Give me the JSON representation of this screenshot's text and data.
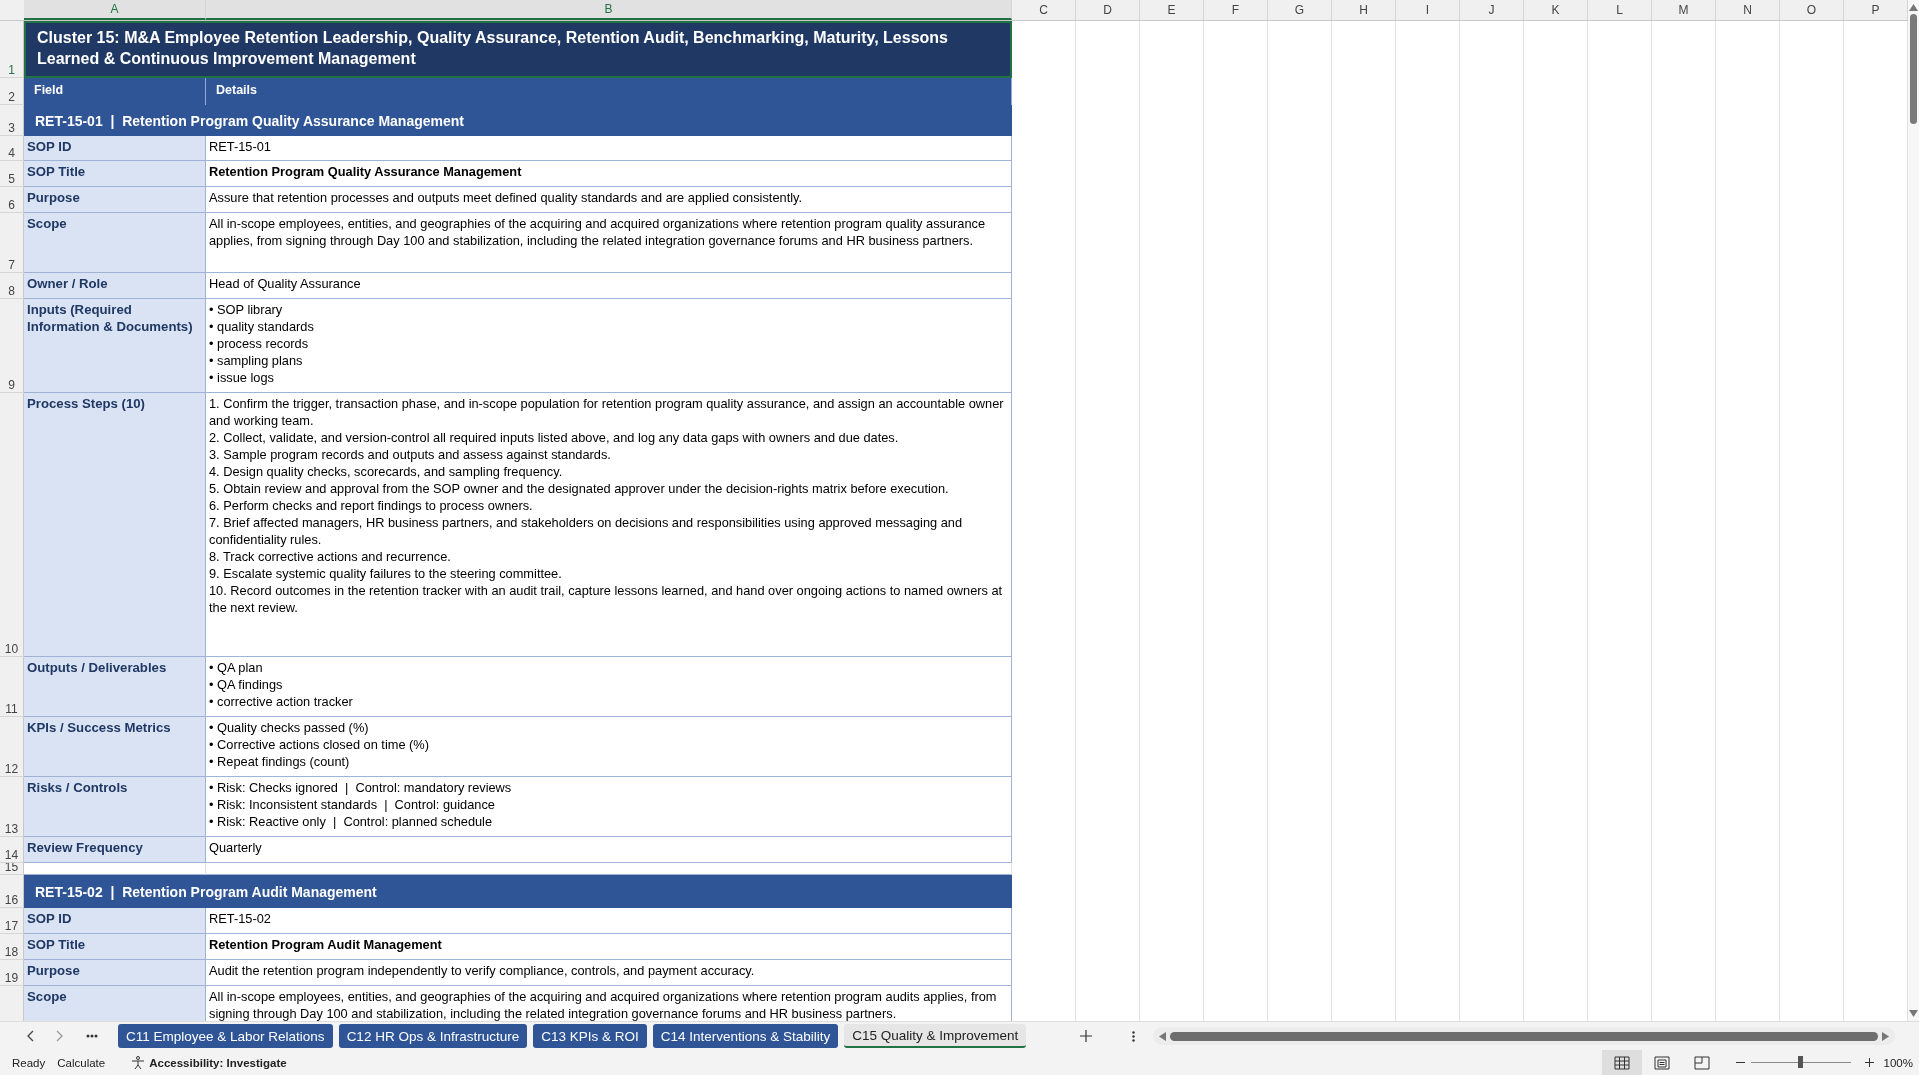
{
  "columns": [
    {
      "letter": "A",
      "selected": true
    },
    {
      "letter": "B",
      "selected": true
    },
    {
      "letter": "C",
      "selected": false
    },
    {
      "letter": "D",
      "selected": false
    },
    {
      "letter": "E",
      "selected": false
    },
    {
      "letter": "F",
      "selected": false
    },
    {
      "letter": "G",
      "selected": false
    },
    {
      "letter": "H",
      "selected": false
    },
    {
      "letter": "I",
      "selected": false
    },
    {
      "letter": "J",
      "selected": false
    },
    {
      "letter": "K",
      "selected": false
    },
    {
      "letter": "L",
      "selected": false
    },
    {
      "letter": "M",
      "selected": false
    },
    {
      "letter": "N",
      "selected": false
    },
    {
      "letter": "O",
      "selected": false
    },
    {
      "letter": "P",
      "selected": false
    }
  ],
  "rows": [
    {
      "number": "1",
      "kind": "title",
      "selected": true,
      "text": "Cluster 15: M&A Employee Retention Leadership, Quality Assurance, Retention Audit, Benchmarking, Maturity, Lessons Learned & Continuous Improvement Management"
    },
    {
      "number": "2",
      "kind": "header",
      "selected": false,
      "cells": [
        "Field",
        "Details"
      ]
    },
    {
      "number": "3",
      "kind": "section",
      "selected": false,
      "text": "RET-15-01  |  Retention Program Quality Assurance Management"
    },
    {
      "number": "4",
      "kind": "field",
      "selected": false,
      "label": "SOP ID",
      "bold": false,
      "lines": [
        "RET-15-01"
      ]
    },
    {
      "number": "5",
      "kind": "field",
      "selected": false,
      "label": "SOP Title",
      "bold": true,
      "lines": [
        "Retention Program Quality Assurance Management"
      ]
    },
    {
      "number": "6",
      "kind": "field",
      "selected": false,
      "label": "Purpose",
      "bold": false,
      "lines": [
        "Assure that retention processes and outputs meet defined quality standards and are applied consistently."
      ]
    },
    {
      "number": "7",
      "kind": "field",
      "selected": false,
      "label": "Scope",
      "bold": false,
      "lines": [
        "All in-scope employees, entities, and geographies of the acquiring and acquired organizations where retention program quality assurance applies, from signing through Day 100 and stabilization, including the related integration governance forums and HR business partners."
      ]
    },
    {
      "number": "8",
      "kind": "field",
      "selected": false,
      "label": "Owner / Role",
      "bold": false,
      "lines": [
        "Head of Quality Assurance"
      ]
    },
    {
      "number": "9",
      "kind": "field",
      "selected": false,
      "label": "Inputs (Required Information & Documents)",
      "bold": false,
      "lines": [
        "• SOP library",
        "• quality standards",
        "• process records",
        "• sampling plans",
        "• issue logs"
      ]
    },
    {
      "number": "10",
      "kind": "field",
      "selected": false,
      "label": "Process Steps (10)",
      "bold": false,
      "lines": [
        "1. Confirm the trigger, transaction phase, and in-scope population for retention program quality assurance, and assign an accountable owner and working team.",
        "2. Collect, validate, and version-control all required inputs listed above, and log any data gaps with owners and due dates.",
        "3. Sample program records and outputs and assess against standards.",
        "4. Design quality checks, scorecards, and sampling frequency.",
        "5. Obtain review and approval from the SOP owner and the designated approver under the decision-rights matrix before execution.",
        "6. Perform checks and report findings to process owners.",
        "7. Brief affected managers, HR business partners, and stakeholders on decisions and responsibilities using approved messaging and confidentiality rules.",
        "8. Track corrective actions and recurrence.",
        "9. Escalate systemic quality failures to the steering committee.",
        "10. Record outcomes in the retention tracker with an audit trail, capture lessons learned, and hand over ongoing actions to named owners at the next review."
      ]
    },
    {
      "number": "11",
      "kind": "field",
      "selected": false,
      "label": "Outputs / Deliverables",
      "bold": false,
      "lines": [
        "• QA plan",
        "• QA findings",
        "• corrective action tracker"
      ]
    },
    {
      "number": "12",
      "kind": "field",
      "selected": false,
      "label": "KPIs / Success Metrics",
      "bold": false,
      "lines": [
        "• Quality checks passed (%)",
        "• Corrective actions closed on time (%)",
        "• Repeat findings (count)"
      ]
    },
    {
      "number": "13",
      "kind": "field",
      "selected": false,
      "label": "Risks / Controls",
      "bold": false,
      "lines": [
        "• Risk: Checks ignored  |  Control: mandatory reviews",
        "• Risk: Inconsistent standards  |  Control: guidance",
        "• Risk: Reactive only  |  Control: planned schedule"
      ]
    },
    {
      "number": "14",
      "kind": "field",
      "selected": false,
      "label": "Review Frequency",
      "bold": false,
      "lines": [
        "Quarterly"
      ]
    },
    {
      "number": "15",
      "kind": "spacer",
      "selected": false
    },
    {
      "number": "16",
      "kind": "section",
      "selected": false,
      "text": "RET-15-02  |  Retention Program Audit Management"
    },
    {
      "number": "17",
      "kind": "field",
      "selected": false,
      "label": "SOP ID",
      "bold": false,
      "lines": [
        "RET-15-02"
      ]
    },
    {
      "number": "18",
      "kind": "field",
      "selected": false,
      "label": "SOP Title",
      "bold": true,
      "lines": [
        "Retention Program Audit Management"
      ]
    },
    {
      "number": "19",
      "kind": "field",
      "selected": false,
      "label": "Purpose",
      "bold": false,
      "lines": [
        "Audit the retention program independently to verify compliance, controls, and payment accuracy."
      ]
    },
    {
      "kind": "field",
      "label": "Scope",
      "bold": false,
      "lines": [
        "All in-scope employees, entities, and geographies of the acquiring and acquired organizations where retention program audits applies, from signing through Day 100 and stabilization, including the related integration governance forums and HR business partners."
      ]
    }
  ],
  "sheet_tabs": [
    {
      "label": "C11 Employee & Labor Relations",
      "selected": false
    },
    {
      "label": "C12 HR Ops & Infrastructure",
      "selected": false
    },
    {
      "label": "C13 KPIs & ROI",
      "selected": false
    },
    {
      "label": "C14 Interventions & Stability",
      "selected": false
    },
    {
      "label": "C15 Quality & Improvement",
      "selected": true
    }
  ],
  "status_bar": {
    "ready": "Ready",
    "calculate": "Calculate",
    "accessibility": "Accessibility: Investigate",
    "zoom": "100%",
    "level": 0.5
  }
}
